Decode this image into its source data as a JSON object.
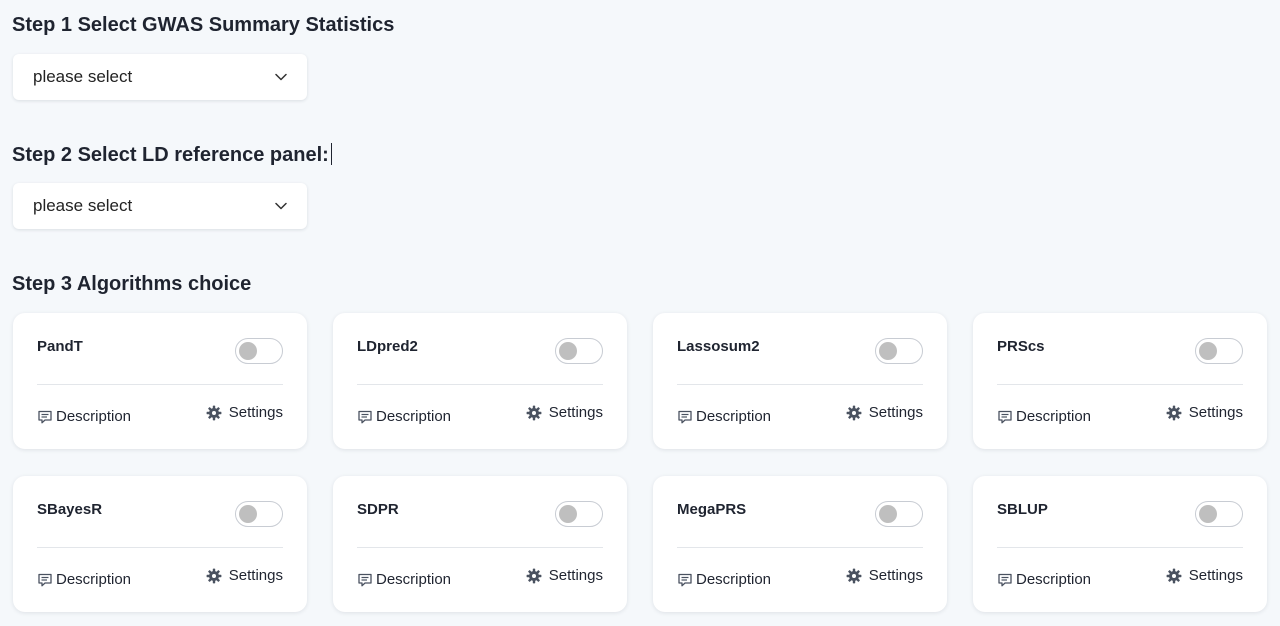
{
  "step1": {
    "title": "Step 1 Select GWAS Summary Statistics",
    "select_value": "please select"
  },
  "step2": {
    "title": "Step 2 Select LD reference panel:",
    "select_value": "please select"
  },
  "step3": {
    "title": "Step 3 Algorithms choice",
    "description_label": "Description",
    "settings_label": "Settings",
    "algorithms": [
      {
        "name": "PandT",
        "enabled": false
      },
      {
        "name": "LDpred2",
        "enabled": false
      },
      {
        "name": "Lassosum2",
        "enabled": false
      },
      {
        "name": "PRScs",
        "enabled": false
      },
      {
        "name": "SBayesR",
        "enabled": false
      },
      {
        "name": "SDPR",
        "enabled": false
      },
      {
        "name": "MegaPRS",
        "enabled": false
      },
      {
        "name": "SBLUP",
        "enabled": false
      }
    ]
  },
  "colors": {
    "background": "#f5f8fb",
    "card": "#ffffff",
    "toggle_knob_off": "#bfbfbf",
    "icon": "#4a5260"
  },
  "icons": {
    "select": "chevron-down-icon",
    "description": "comment-icon",
    "settings": "gear-icon"
  }
}
